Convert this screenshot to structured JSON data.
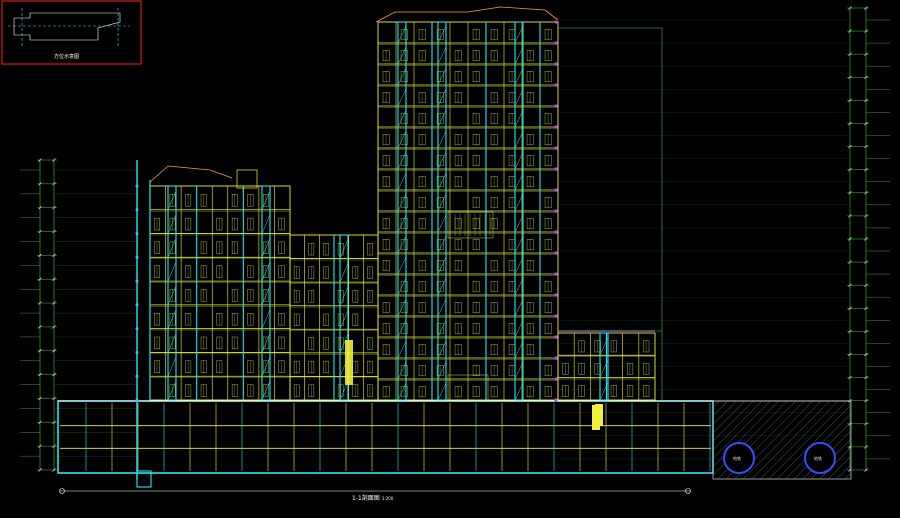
{
  "key_plan": {
    "caption": "方位示意图"
  },
  "section": {
    "title": "1-1剖面图",
    "scale": "1:200"
  },
  "tunnels": {
    "left_label": "地铁",
    "right_label": "地铁"
  },
  "colors": {
    "background": "#000000",
    "frame": "#d21a1a",
    "structure": "#f2ef3a",
    "stairs": "#27e6ef",
    "detail": "#c9e24d",
    "level_lines": "#4dbd4d",
    "cut": "#ffffff",
    "tunnel": "#3050ff",
    "hatch": "#b8bcc4",
    "roof": "#ff9a3a"
  },
  "levels": {
    "above_ground": 18,
    "podium": 8,
    "basement": 3
  },
  "drawing": {
    "element_types": [
      "grid-bay",
      "stair-core",
      "door-window",
      "level-line",
      "dimension-tick",
      "earth-hatch",
      "tunnel-circle"
    ]
  }
}
